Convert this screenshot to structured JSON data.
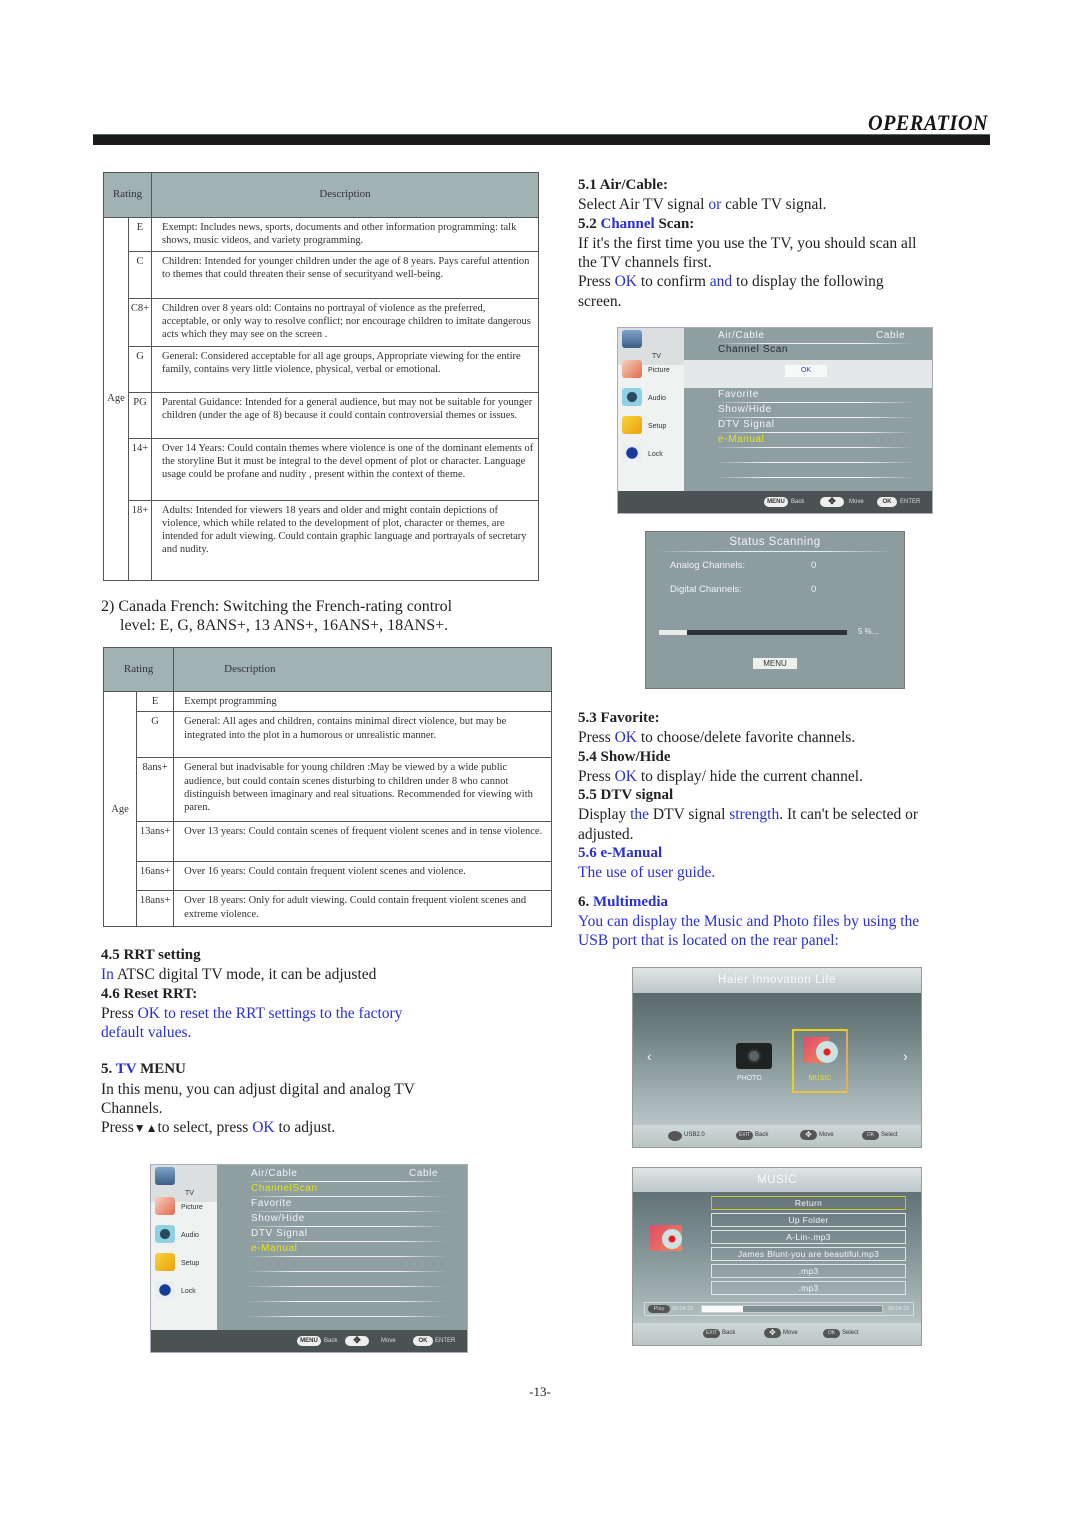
{
  "header": {
    "title": "OPERATION"
  },
  "us_table": {
    "headers": {
      "rating": "Rating",
      "description": "Description"
    },
    "group_label": "Age",
    "rows": [
      {
        "code": "E",
        "desc": "Exempt: Includes news, sports, documents and other information programming: talk shows, music videos, and variety programming."
      },
      {
        "code": "C",
        "desc": "Children: Intended for younger children under the age of 8 years. Pays careful attention to themes that could threaten their sense of securityand well-being."
      },
      {
        "code": "C8+",
        "desc": "Children over 8 years old: Contains no portrayal of violence as the preferred, acceptable, or only way to resolve conflict; nor encourage children to imitate dangerous acts which they may see on the screen ."
      },
      {
        "code": "G",
        "desc": "General: Considered acceptable for all age groups, Appropriate viewing for the entire family, contains very little violence, physical, verbal or emotional."
      },
      {
        "code": "PG",
        "desc": "Parental Guidance: Intended for a general audience, but may not be suitable for younger children (under the age of 8) because it could contain controversial themes or issues."
      },
      {
        "code": "14+",
        "desc": "Over 14 Years: Could contain themes where violence is one of the dominant elements of the storyline But it must be integral to the devel opment of plot or character. Language usage could be profane and nudity , present within the context of theme."
      },
      {
        "code": "18+",
        "desc": "Adults: Intended for viewers 18 years and older and might contain depictions of  violence, which while related to the development of plot,  character or themes, are intended for adult  viewing. Could contain graphic language and portrayals of secretary and nudity."
      }
    ]
  },
  "canada_french": {
    "line1": "2) Canada French: Switching the French-rating control",
    "line2": "level: E, G, 8ANS+, 13 ANS+, 16ANS+, 18ANS+."
  },
  "fr_table": {
    "headers": {
      "rating": "Rating",
      "description": "Description"
    },
    "group_label": "Age",
    "rows": [
      {
        "code": "E",
        "desc": "Exempt programming"
      },
      {
        "code": "G",
        "desc": "General: All ages and children, contains minimal direct violence, but may be integrated into the plot in a humorous or unrealistic manner."
      },
      {
        "code": "8ans+",
        "desc": "General but inadvisable for young children :May be viewed by a wide public audience, but could contain scenes disturbing to children under 8 who cannot distinguish between imaginary and real situations. Recommended for viewing with paren."
      },
      {
        "code": "13ans+",
        "desc": "Over 13 years: Could contain scenes of frequent violent scenes and in tense violence."
      },
      {
        "code": "16ans+",
        "desc": "Over 16 years: Could contain frequent violent scenes and violence."
      },
      {
        "code": "18ans+",
        "desc": "Over 18 years: Only for adult viewing. Could contain frequent violent  scenes and extreme violence."
      }
    ]
  },
  "left_text": {
    "rrt_heading": "4.5 RRT setting",
    "rrt_in": "In",
    "rrt_body": " ATSC digital TV mode, it can be adjusted",
    "reset_heading": "4.6 Reset RRT:",
    "reset_press": "Press ",
    "reset_blue1": "OK to reset the RRT settings to the factory",
    "reset_blue2": "default values.",
    "tvmenu_num": "5. ",
    "tvmenu_tv": "TV",
    "tvmenu_rest": " MENU",
    "tvmenu_body1": "In this menu, you can adjust digital and analog TV",
    "tvmenu_body2": "Channels.",
    "tvmenu_press": "Press",
    "tvmenu_arrows": "▼▲",
    "tvmenu_sel": "to select, press ",
    "tvmenu_ok": "OK",
    "tvmenu_adj": " to adjust."
  },
  "right_text": {
    "s51_heading": "5.1 Air/Cable:",
    "s51_a": "Select Air TV signal ",
    "s51_or": "or",
    "s51_b": " cable TV signal.",
    "s52_num": "5.2 ",
    "s52_channel": "Channel",
    "s52_scan": " Scan:",
    "s52_body1": "If it's the first time you use the TV, you should scan all",
    "s52_body2": "the TV channels first.",
    "s52_press": "Press ",
    "s52_ok": "OK",
    "s52_confirm": " to confirm ",
    "s52_and": "and",
    "s52_display": " to display the following",
    "s52_screen": "screen.",
    "s53_heading": "5.3 Favorite:",
    "s53_press": "Press ",
    "s53_ok": "OK",
    "s53_rest": " to choose/delete  favorite channels.",
    "s54_heading": "5.4 Show/Hide",
    "s54_press": "Press ",
    "s54_ok": "OK",
    "s54_rest": " to display/ hide the current channel.",
    "s55_heading": "5.5 DTV signal",
    "s55_a": "Display ",
    "s55_the": "the",
    "s55_b": " DTV signal ",
    "s55_strength": "strength",
    "s55_c": ". It can't be selected or",
    "s55_d": "adjusted.",
    "s56_heading": "5.6 e-Manual",
    "s56_body": "The use of user guide.",
    "s6_num": "6. ",
    "s6_title": "Multimedia",
    "s6_body1": "You can display the Music and Photo files by using the",
    "s6_body2": "USB port that is located on the rear panel:"
  },
  "tv_menu_a": {
    "sidebar": [
      "TV",
      "Picture",
      "Audio",
      "Setup",
      "Lock"
    ],
    "items": [
      {
        "label": "Air/Cable",
        "value": "Cable"
      },
      {
        "label": "ChannelScan"
      },
      {
        "label": "Favorite"
      },
      {
        "label": "Show/Hide"
      },
      {
        "label": "DTV Signal"
      },
      {
        "label": "e-Manual"
      }
    ],
    "footer": {
      "menu_key": "MENU",
      "back": "Back",
      "move": "Move",
      "ok_key": "OK",
      "enter": "ENTER"
    }
  },
  "tv_menu_b": {
    "sidebar": [
      "TV",
      "Picture",
      "Audio",
      "Setup",
      "Lock"
    ],
    "items": [
      {
        "label": "Air/Cable",
        "value": "Cable"
      },
      {
        "label": "Channel Scan"
      },
      {
        "label": "Favorite"
      },
      {
        "label": "Show/Hide"
      },
      {
        "label": "DTV Signal"
      },
      {
        "label": "e-Manual"
      }
    ],
    "ok_button": "OK",
    "footer": {
      "menu_key": "MENU",
      "back": "Back",
      "move": "Move",
      "ok_key": "OK",
      "enter": "ENTER"
    }
  },
  "scan_status": {
    "title": "Status Scanning",
    "analog_label": "Analog Channels:",
    "analog_value": "0",
    "digital_label": "Digital Channels:",
    "digital_value": "0",
    "progress_percent": 5,
    "progress_text": "5 %...",
    "menu_button": "MENU"
  },
  "multimedia_home": {
    "title": "Haier Innovation Life",
    "items": [
      "PHOTO",
      "MUSIC"
    ],
    "selected": "MUSIC",
    "footer": {
      "usb": "USB2.0",
      "exit_key": "EXIT",
      "back": "Back",
      "move": "Move",
      "ok_key": "OK",
      "select": "Select"
    }
  },
  "music_browser": {
    "title": "MUSIC",
    "files": [
      "Return",
      "Up Folder",
      "A-Lin-.mp3",
      "James Blunt-you are beautiful.mp3",
      ".mp3",
      ".mp3"
    ],
    "selected_index": 0,
    "play_label": "Play",
    "time_elapsed": "00:04:22",
    "time_total": "00:04:22",
    "progress_percent": 23,
    "footer": {
      "exit_key": "EXIT",
      "back": "Back",
      "move": "Move",
      "ok_key": "OK",
      "select": "Select"
    }
  },
  "page_number": "-13-",
  "colors": {
    "accent_blue": "#2a2fd8",
    "highlight_yellow": "#e5e41a",
    "table_header": "#a2b1b4"
  }
}
